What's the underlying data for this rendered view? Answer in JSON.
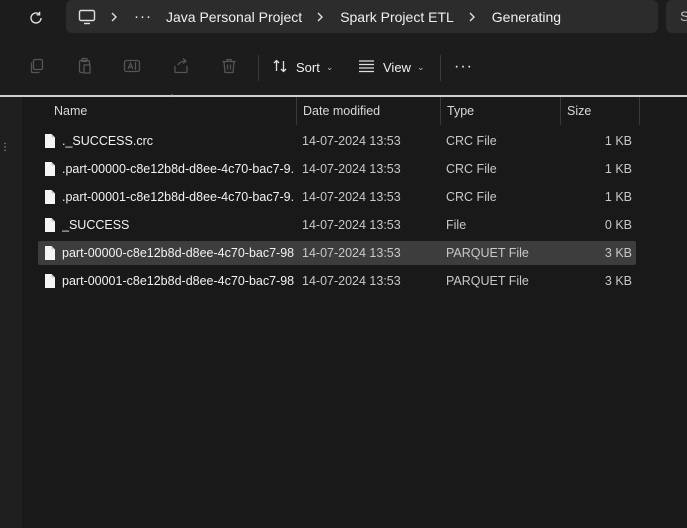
{
  "breadcrumb": {
    "more": "···",
    "items": [
      "Java Personal Project",
      "Spark Project ETL",
      "Generating"
    ]
  },
  "search": {
    "text": "S"
  },
  "toolbar": {
    "sort_label": "Sort",
    "view_label": "View",
    "more_label": "···"
  },
  "columns": {
    "name": "Name",
    "date": "Date modified",
    "type": "Type",
    "size": "Size"
  },
  "files": [
    {
      "name": "._SUCCESS.crc",
      "date": "14-07-2024 13:53",
      "type": "CRC File",
      "size": "1 KB",
      "selected": false
    },
    {
      "name": ".part-00000-c8e12b8d-d8ee-4c70-bac7-9...",
      "date": "14-07-2024 13:53",
      "type": "CRC File",
      "size": "1 KB",
      "selected": false
    },
    {
      "name": ".part-00001-c8e12b8d-d8ee-4c70-bac7-9...",
      "date": "14-07-2024 13:53",
      "type": "CRC File",
      "size": "1 KB",
      "selected": false
    },
    {
      "name": "_SUCCESS",
      "date": "14-07-2024 13:53",
      "type": "File",
      "size": "0 KB",
      "selected": false
    },
    {
      "name": "part-00000-c8e12b8d-d8ee-4c70-bac7-98...",
      "date": "14-07-2024 13:53",
      "type": "PARQUET File",
      "size": "3 KB",
      "selected": true
    },
    {
      "name": "part-00001-c8e12b8d-d8ee-4c70-bac7-98...",
      "date": "14-07-2024 13:53",
      "type": "PARQUET File",
      "size": "3 KB",
      "selected": false
    }
  ],
  "colors": {
    "background": "#191919",
    "selected_row": "#3d3d3d",
    "address_bar": "#2c2c2c"
  }
}
